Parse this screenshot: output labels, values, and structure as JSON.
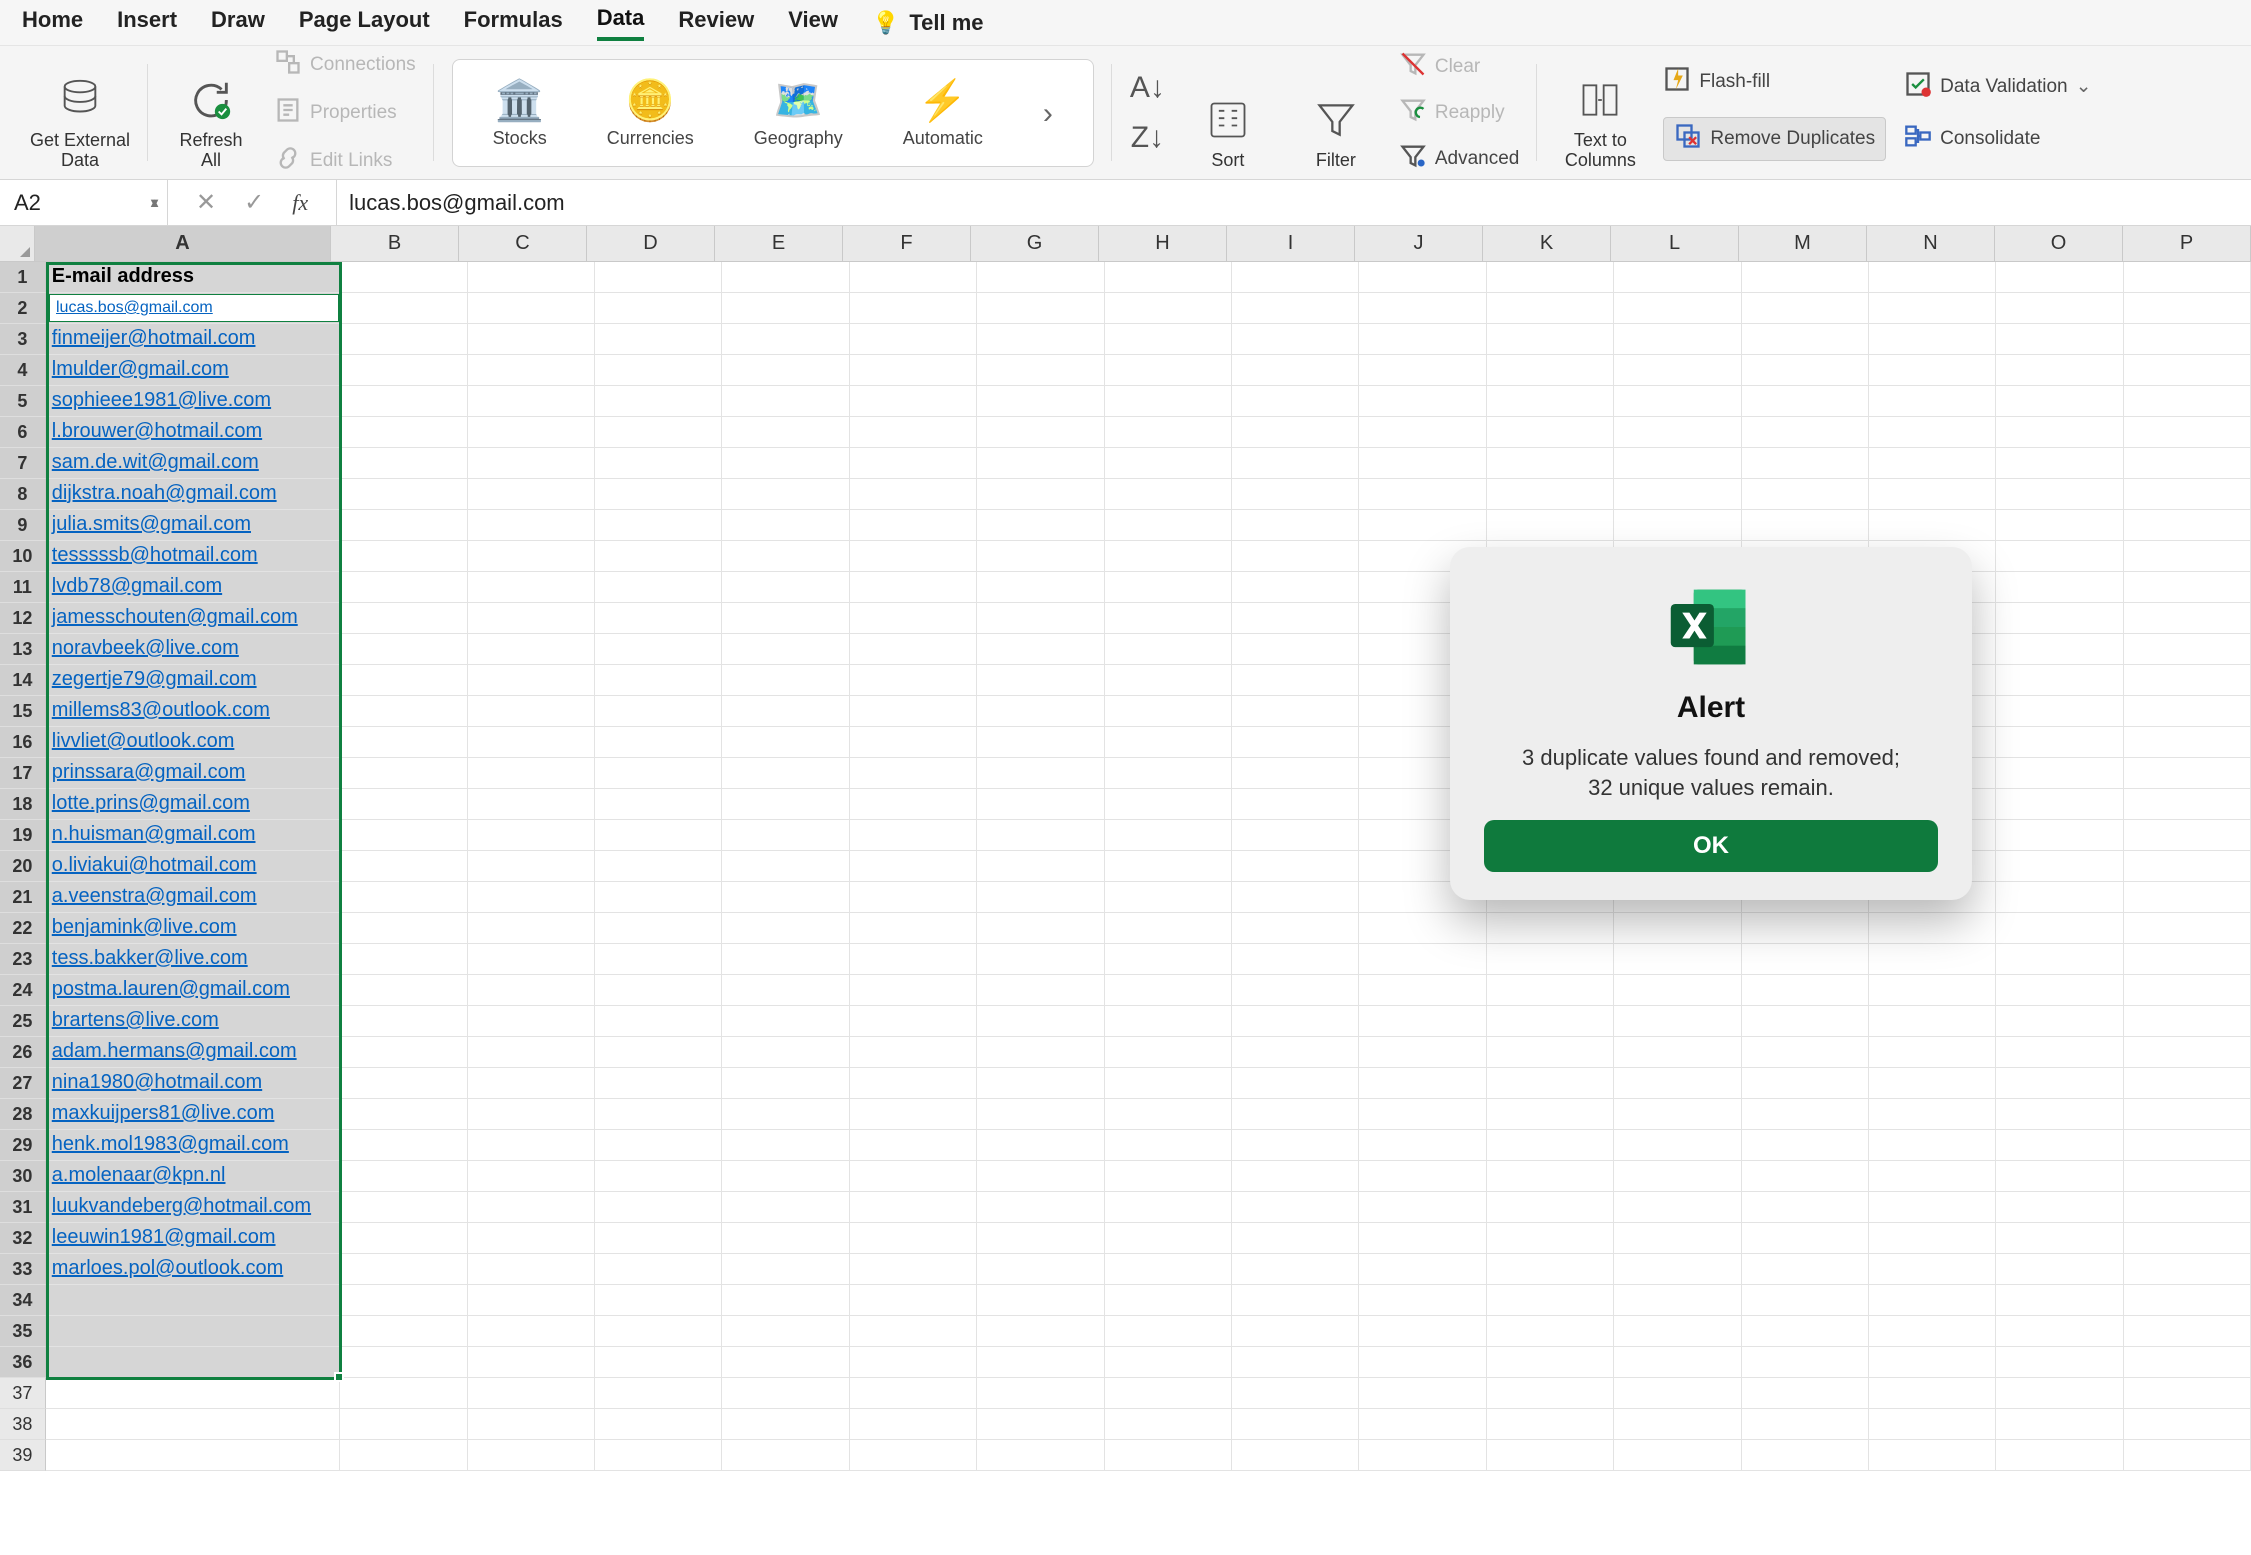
{
  "tabs": {
    "items": [
      "Home",
      "Insert",
      "Draw",
      "Page Layout",
      "Formulas",
      "Data",
      "Review",
      "View"
    ],
    "active": "Data",
    "tellme": "Tell me"
  },
  "ribbon": {
    "get_external": "Get External\nData",
    "refresh_all": "Refresh\nAll",
    "connections": "Connections",
    "properties": "Properties",
    "edit_links": "Edit Links",
    "datatypes": {
      "stocks": "Stocks",
      "currencies": "Currencies",
      "geography": "Geography",
      "automatic": "Automatic"
    },
    "sort": "Sort",
    "filter": "Filter",
    "clear": "Clear",
    "reapply": "Reapply",
    "advanced": "Advanced",
    "text_to_columns": "Text to\nColumns",
    "flash_fill": "Flash-fill",
    "remove_duplicates": "Remove Duplicates",
    "data_validation": "Data Validation",
    "consolidate": "Consolidate"
  },
  "formula_bar": {
    "namebox": "A2",
    "value": "lucas.bos@gmail.com",
    "fx": "fx"
  },
  "columns": [
    "A",
    "B",
    "C",
    "D",
    "E",
    "F",
    "G",
    "H",
    "I",
    "J",
    "K",
    "L",
    "M",
    "N",
    "O",
    "P"
  ],
  "header_cell": "E-mail address",
  "emails": [
    "lucas.bos@gmail.com",
    "finmeijer@hotmail.com",
    "lmulder@gmail.com",
    "sophieee1981@live.com",
    "l.brouwer@hotmail.com",
    "sam.de.wit@gmail.com",
    "dijkstra.noah@gmail.com",
    "julia.smits@gmail.com",
    "tesssssb@hotmail.com",
    "lvdb78@gmail.com",
    "jamesschouten@gmail.com",
    "noravbeek@live.com",
    "zegertje79@gmail.com",
    "millems83@outlook.com",
    "livvliet@outlook.com",
    "prinssara@gmail.com",
    "lotte.prins@gmail.com",
    "n.huisman@gmail.com",
    "o.liviakui@hotmail.com",
    "a.veenstra@gmail.com",
    "benjamink@live.com",
    "tess.bakker@live.com",
    "postma.lauren@gmail.com",
    "brartens@live.com",
    "adam.hermans@gmail.com",
    "nina1980@hotmail.com",
    "maxkuijpers81@live.com",
    "henk.mol1983@gmail.com",
    "a.molenaar@kpn.nl",
    "luukvandeberg@hotmail.com",
    "leeuwin1981@gmail.com",
    "marloes.pol@outlook.com"
  ],
  "total_rows": 39,
  "selection_end_row": 36,
  "alert": {
    "title": "Alert",
    "line1": "3 duplicate values found and removed;",
    "line2": "32 unique values remain.",
    "ok": "OK"
  }
}
